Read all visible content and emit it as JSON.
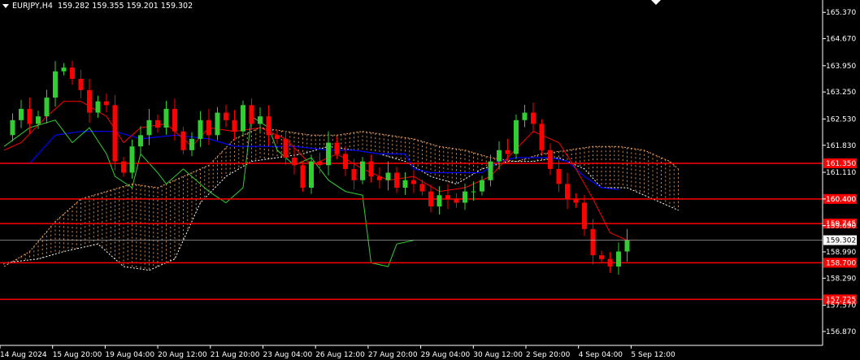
{
  "header": {
    "symbol": "EURJPY,H4",
    "ohlc": "159.282 159.355 159.201 159.302"
  },
  "colors": {
    "background": "#000000",
    "bull": "#32cd32",
    "bear": "#ff0000",
    "tenkan": "#ff0000",
    "kijun": "#0000ff",
    "chikou": "#32cd32",
    "span_a": "#f4a460",
    "span_b": "#ffffff",
    "level": "#ff0000",
    "axis": "#ffffff"
  },
  "chart_data": {
    "type": "candlestick",
    "ylim": [
      156.5,
      165.7
    ],
    "price_ticks": [
      "165.370",
      "164.670",
      "163.950",
      "163.250",
      "162.530",
      "161.830",
      "161.110",
      "160.400",
      "159.690",
      "158.990",
      "158.290",
      "157.570",
      "156.870"
    ],
    "x_labels": [
      "14 Aug 2024",
      "15 Aug 20:00",
      "19 Aug 04:00",
      "20 Aug 12:00",
      "21 Aug 20:00",
      "23 Aug 04:00",
      "26 Aug 12:00",
      "27 Aug 20:00",
      "29 Aug 04:00",
      "30 Aug 12:00",
      "2 Sep 20:00",
      "4 Sep 04:00",
      "5 Sep 12:00"
    ],
    "current_price": {
      "value": 159.302,
      "label": "159.302"
    },
    "levels": [
      {
        "value": 161.35,
        "label": "161.350"
      },
      {
        "value": 160.4,
        "label": "160.400"
      },
      {
        "value": 159.745,
        "label": "159.745"
      },
      {
        "value": 158.7,
        "label": "158.700"
      },
      {
        "value": 157.725,
        "label": "157.725"
      }
    ],
    "anchors": [
      162.1,
      162.5,
      162.8,
      162.4,
      162.6,
      163.1,
      163.8,
      163.9,
      163.6,
      163.3,
      162.7,
      163.0,
      162.9,
      161.4,
      161.1,
      161.8,
      162.1,
      162.5,
      162.3,
      162.8,
      162.2,
      161.7,
      162.0,
      162.5,
      162.1,
      162.7,
      162.5,
      162.2,
      162.9,
      162.4,
      162.6,
      162.1,
      162.0,
      161.5,
      161.3,
      160.7,
      161.4,
      161.3,
      161.9,
      161.6,
      161.2,
      160.9,
      161.4,
      161.0,
      160.9,
      161.1,
      160.7,
      160.9,
      160.8,
      160.6,
      160.2,
      160.5,
      160.4,
      160.3,
      160.6,
      160.6,
      160.9,
      161.4,
      161.7,
      161.6,
      162.5,
      162.7,
      162.4,
      161.7,
      161.2,
      160.8,
      160.4,
      160.3,
      159.6,
      158.9,
      158.8,
      158.6,
      159.0,
      159.3
    ],
    "ichimoku": {
      "tenkan": [
        [
          0,
          161.7
        ],
        [
          2,
          161.9
        ],
        [
          5,
          162.6
        ],
        [
          7,
          163.0
        ],
        [
          9,
          163.0
        ],
        [
          12,
          162.6
        ],
        [
          14,
          161.9
        ],
        [
          16,
          162.3
        ],
        [
          19,
          162.4
        ],
        [
          22,
          161.8
        ],
        [
          24,
          162.3
        ],
        [
          27,
          162.2
        ],
        [
          30,
          162.3
        ],
        [
          33,
          162.0
        ],
        [
          36,
          161.3
        ],
        [
          39,
          161.6
        ],
        [
          42,
          161.2
        ],
        [
          45,
          160.9
        ],
        [
          48,
          161.0
        ],
        [
          51,
          160.6
        ],
        [
          54,
          160.7
        ],
        [
          57,
          161.0
        ],
        [
          59,
          161.5
        ],
        [
          62,
          162.2
        ],
        [
          65,
          161.9
        ],
        [
          67,
          161.2
        ],
        [
          69,
          160.4
        ],
        [
          71,
          159.5
        ],
        [
          73,
          159.3
        ]
      ],
      "kijun": [
        [
          0,
          161.35
        ],
        [
          3,
          161.35
        ],
        [
          6,
          162.1
        ],
        [
          9,
          162.2
        ],
        [
          13,
          162.2
        ],
        [
          16,
          162.0
        ],
        [
          20,
          162.1
        ],
        [
          24,
          162.0
        ],
        [
          27,
          161.8
        ],
        [
          30,
          161.8
        ],
        [
          34,
          161.8
        ],
        [
          38,
          161.7
        ],
        [
          41,
          161.7
        ],
        [
          44,
          161.6
        ],
        [
          47,
          161.6
        ],
        [
          48,
          161.2
        ],
        [
          50,
          161.1
        ],
        [
          53,
          161.1
        ],
        [
          56,
          161.1
        ],
        [
          58,
          161.4
        ],
        [
          60,
          161.5
        ],
        [
          64,
          161.5
        ],
        [
          66,
          161.4
        ],
        [
          68,
          161.0
        ],
        [
          70,
          160.7
        ],
        [
          72,
          160.65
        ]
      ],
      "chikou": [
        [
          0,
          161.8
        ],
        [
          3,
          162.3
        ],
        [
          6,
          162.5
        ],
        [
          8,
          161.9
        ],
        [
          10,
          162.3
        ],
        [
          12,
          161.6
        ],
        [
          13,
          161.0
        ],
        [
          15,
          160.7
        ],
        [
          16,
          161.6
        ],
        [
          18,
          161.1
        ],
        [
          19,
          160.8
        ],
        [
          21,
          161.2
        ],
        [
          22,
          161.0
        ],
        [
          24,
          160.6
        ],
        [
          26,
          160.3
        ],
        [
          28,
          160.7
        ],
        [
          29,
          162.6
        ],
        [
          31,
          162.3
        ],
        [
          32,
          161.7
        ],
        [
          34,
          161.3
        ],
        [
          36,
          161.5
        ],
        [
          38,
          160.9
        ],
        [
          40,
          160.6
        ],
        [
          42,
          160.5
        ],
        [
          43,
          158.7
        ],
        [
          45,
          158.6
        ],
        [
          46,
          159.2
        ],
        [
          48,
          159.3
        ]
      ],
      "span_a": [
        [
          0,
          158.6
        ],
        [
          3,
          159.0
        ],
        [
          6,
          159.8
        ],
        [
          9,
          160.4
        ],
        [
          12,
          160.6
        ],
        [
          15,
          160.8
        ],
        [
          18,
          160.7
        ],
        [
          21,
          161.0
        ],
        [
          24,
          161.3
        ],
        [
          27,
          162.0
        ],
        [
          30,
          162.3
        ],
        [
          33,
          162.2
        ],
        [
          36,
          162.1
        ],
        [
          39,
          162.1
        ],
        [
          42,
          162.2
        ],
        [
          45,
          162.1
        ],
        [
          48,
          162.0
        ],
        [
          51,
          161.8
        ],
        [
          54,
          161.7
        ],
        [
          57,
          161.5
        ],
        [
          60,
          161.4
        ],
        [
          63,
          161.6
        ],
        [
          66,
          161.7
        ],
        [
          69,
          161.8
        ],
        [
          72,
          161.8
        ],
        [
          75,
          161.7
        ],
        [
          78,
          161.4
        ],
        [
          79,
          161.2
        ]
      ],
      "span_b": [
        [
          0,
          158.7
        ],
        [
          4,
          158.8
        ],
        [
          7,
          159.0
        ],
        [
          9,
          159.1
        ],
        [
          11,
          159.2
        ],
        [
          14,
          158.6
        ],
        [
          17,
          158.5
        ],
        [
          20,
          158.8
        ],
        [
          23,
          160.3
        ],
        [
          26,
          161.0
        ],
        [
          29,
          161.4
        ],
        [
          32,
          161.5
        ],
        [
          35,
          161.6
        ],
        [
          38,
          161.8
        ],
        [
          41,
          161.7
        ],
        [
          44,
          161.6
        ],
        [
          47,
          161.4
        ],
        [
          50,
          161.0
        ],
        [
          53,
          160.8
        ],
        [
          56,
          161.2
        ],
        [
          59,
          161.4
        ],
        [
          62,
          161.4
        ],
        [
          65,
          161.5
        ],
        [
          68,
          161.2
        ],
        [
          70,
          160.7
        ],
        [
          73,
          160.7
        ],
        [
          76,
          160.4
        ],
        [
          79,
          160.1
        ]
      ]
    }
  }
}
